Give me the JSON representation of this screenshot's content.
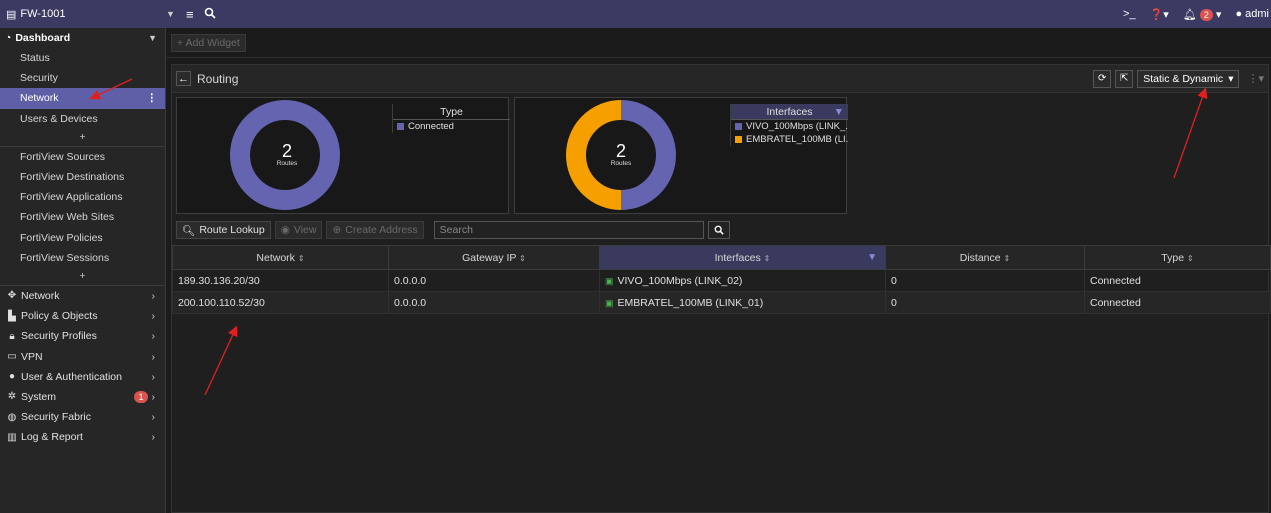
{
  "topbar": {
    "device": "FW-1001",
    "user": "admi",
    "alert_count": "2"
  },
  "sidebar": {
    "dashboard_label": "Dashboard",
    "sub_items": [
      {
        "label": "Status"
      },
      {
        "label": "Security"
      },
      {
        "label": "Network",
        "active": true
      },
      {
        "label": "Users & Devices"
      }
    ],
    "plus": "+",
    "fortiview_items": [
      {
        "label": "FortiView Sources"
      },
      {
        "label": "FortiView Destinations"
      },
      {
        "label": "FortiView Applications"
      },
      {
        "label": "FortiView Web Sites"
      },
      {
        "label": "FortiView Policies"
      },
      {
        "label": "FortiView Sessions"
      }
    ],
    "main_items": [
      {
        "label": "Network",
        "icon": "network-icon"
      },
      {
        "label": "Policy & Objects",
        "icon": "policy-icon"
      },
      {
        "label": "Security Profiles",
        "icon": "lock-icon"
      },
      {
        "label": "VPN",
        "icon": "laptop-icon"
      },
      {
        "label": "User & Authentication",
        "icon": "user-icon"
      },
      {
        "label": "System",
        "icon": "gear-icon",
        "badge": "1"
      },
      {
        "label": "Security Fabric",
        "icon": "fabric-icon"
      },
      {
        "label": "Log & Report",
        "icon": "chart-icon"
      }
    ]
  },
  "content": {
    "add_widget": "+ Add Widget",
    "panel_title": "Routing",
    "route_filter": "Static & Dynamic",
    "chart_type": {
      "legend_title": "Type",
      "center_value": "2",
      "center_label": "Routes",
      "entries": [
        {
          "label": "Connected",
          "color": "#6464b0",
          "value": 2
        }
      ]
    },
    "chart_interfaces": {
      "legend_title": "Interfaces",
      "center_value": "2",
      "center_label": "Routes",
      "entries": [
        {
          "label": "VIVO_100Mbps (LINK_...",
          "color": "#6464b0",
          "value": 1
        },
        {
          "label": "EMBRATEL_100MB (LI...",
          "color": "#f5a000",
          "value": 1
        }
      ]
    },
    "toolbar": {
      "route_lookup": "Route Lookup",
      "view": "View",
      "create_address": "Create Address",
      "search_placeholder": "Search"
    },
    "table": {
      "columns": [
        "Network",
        "Gateway IP",
        "Interfaces",
        "Distance",
        "Type"
      ],
      "rows": [
        {
          "network": "189.30.136.20/30",
          "gateway": "0.0.0.0",
          "interface": "VIVO_100Mbps (LINK_02)",
          "distance": "0",
          "type": "Connected"
        },
        {
          "network": "200.100.110.52/30",
          "gateway": "0.0.0.0",
          "interface": "EMBRATEL_100MB (LINK_01)",
          "distance": "0",
          "type": "Connected"
        }
      ]
    }
  },
  "colors": {
    "topbar": "#3a3a62",
    "active_item": "#5f5fa7",
    "connected": "#6464b0",
    "embratel": "#f5a000",
    "annotation_arrow": "#e02020"
  }
}
